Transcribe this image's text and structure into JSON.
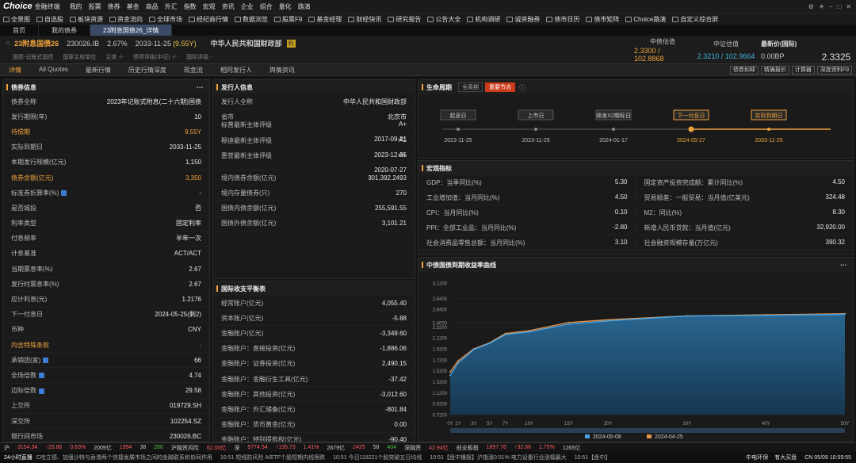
{
  "app": {
    "logo": "Choice",
    "logo_sub": "金融终端"
  },
  "menu": [
    "我的",
    "股票",
    "债券",
    "基金",
    "商品",
    "外汇",
    "指数",
    "宏观",
    "资讯",
    "企业",
    "组合",
    "量化",
    "路演"
  ],
  "toolbar": [
    "全景图",
    "自选股",
    "板块资源",
    "资金流向",
    "全球市场",
    "经纪商行情",
    "数据浏览",
    "股票F9",
    "基金经理",
    "财经快讯",
    "研究报告",
    "公告大全",
    "机构调研",
    "诚资融券",
    "债市日历",
    "债市矩阵",
    "Choice路演",
    "自定义综合屏"
  ],
  "tabs": [
    "首页",
    "我的债券",
    "23附息国债26_详情"
  ],
  "bond": {
    "name": "23附息国债26",
    "code": "230026.IB",
    "rate": "2.67%",
    "maturity": "2033-11-25",
    "maturity_left": "(9.55Y)",
    "issuer": "中华人民共和国财政部",
    "badge": "利",
    "row2": [
      "国债-记账式国债",
      "国家主权单位",
      "主体 -/-",
      "债项评级(中证) -/-",
      "国际评级 -"
    ]
  },
  "quotes": [
    {
      "label": "中债估值",
      "value": "2.3300 / 102.8868"
    },
    {
      "label": "中证估值",
      "value": "2.3210 / 102.9664"
    },
    {
      "label": "最新价(国际)",
      "value": "0.00BP"
    }
  ],
  "last_price": "2.3325",
  "subtabs": [
    "详情",
    "All Quotes",
    "最新行情",
    "历史行情深度",
    "现金流",
    "相同发行人",
    "舆情资讯"
  ],
  "subtab_buttons": [
    "债券如释",
    "精确报价",
    "计算器",
    "深度资料F9"
  ],
  "bond_info": {
    "title": "债券信息",
    "rows": [
      {
        "l": "债券全称",
        "v": "2023年记账式附息(二十六期)国债"
      },
      {
        "l": "发行期限(年)",
        "v": "10"
      },
      {
        "l": "待偿期",
        "v": "9.55Y",
        "hl": true
      },
      {
        "l": "实际到期日",
        "v": "2033-11-25"
      },
      {
        "l": "本期发行规模(亿元)",
        "v": "1,150"
      },
      {
        "l": "债券余额(亿元)",
        "v": "3,350",
        "hl": true
      },
      {
        "l": "标准券折算率(%)",
        "v": "-",
        "mark": true
      },
      {
        "l": "是否城投",
        "v": "否"
      },
      {
        "l": "利率类型",
        "v": "固定利率"
      },
      {
        "l": "付息频率",
        "v": "半年一次"
      },
      {
        "l": "计息基准",
        "v": "ACT/ACT"
      },
      {
        "l": "当期票息率(%)",
        "v": "2.67"
      },
      {
        "l": "发行时票息率(%)",
        "v": "2.67"
      },
      {
        "l": "应计利息(元)",
        "v": "1.2176"
      },
      {
        "l": "下一付息日",
        "v": "2024-05-25(剩2)"
      },
      {
        "l": "币种",
        "v": "CNY"
      },
      {
        "l": "内含特殊条款",
        "v": "-",
        "hl": true
      },
      {
        "l": "承销团(家)",
        "v": "66",
        "mark": true
      },
      {
        "l": "全场倍数",
        "v": "4.74",
        "mark": true
      },
      {
        "l": "边际倍数",
        "v": "29.58",
        "mark": true
      },
      {
        "l": "上交所",
        "v": "019729.SH"
      },
      {
        "l": "深交所",
        "v": "102254.SZ"
      },
      {
        "l": "银行间市场",
        "v": "230026.BC"
      }
    ]
  },
  "issuer_info": {
    "title": "发行人信息",
    "rows": [
      {
        "l": "发行人全称",
        "v": "中华人民共和国财政部"
      },
      {
        "l": "省市",
        "v": "北京市"
      }
    ],
    "ratings": [
      {
        "l": "标普最新主体评级",
        "v": "A+",
        "d": "2017-09-21"
      },
      {
        "l": "穆迪最新主体评级",
        "v": "A1",
        "d": "2023-12-05"
      },
      {
        "l": "惠誉最新主体评级",
        "v": "A+",
        "d": "2020-07-27"
      }
    ],
    "debt_rows": [
      {
        "l": "境内债券余额(亿元)",
        "v": "301,392.2493"
      },
      {
        "l": "境内存量债券(只)",
        "v": "270"
      },
      {
        "l": "国债内债余额(亿元)",
        "v": "255,591.55"
      },
      {
        "l": "国债外债余额(亿元)",
        "v": "3,101.21"
      }
    ]
  },
  "bop": {
    "title": "国际收支平衡表",
    "rows": [
      {
        "l": "经常账户(亿元)",
        "v": "4,055.40"
      },
      {
        "l": "资本账户(亿元)",
        "v": "-5.88"
      },
      {
        "l": "金融账户(亿元)",
        "v": "-3,349.60"
      },
      {
        "l": "金融账户：直接投资(亿元)",
        "v": "-1,886.06"
      },
      {
        "l": "金融账户：证券投资(亿元)",
        "v": "2,490.15"
      },
      {
        "l": "金融账户：金融衍生工具(亿元)",
        "v": "-37.42"
      },
      {
        "l": "金融账户：其他投资(亿元)",
        "v": "-3,012.60"
      },
      {
        "l": "金融账户：外汇储备(亿元)",
        "v": "-801.84"
      },
      {
        "l": "金融账户：货币黄金(亿元)",
        "v": "0.00"
      },
      {
        "l": "金融账户：特别提款权(亿元)",
        "v": "-90.40"
      }
    ]
  },
  "lifecycle": {
    "title": "生命周期",
    "tabs": [
      "全周期",
      "重要节点"
    ],
    "nodes": [
      {
        "label": "起息日",
        "date": "2023-11-25"
      },
      {
        "label": "上市日",
        "date": "2023-11-29"
      },
      {
        "label": "续发X2期标日",
        "date": "2024-01-17"
      },
      {
        "label": "下一付息日",
        "date": "2024-05-27"
      },
      {
        "label": "实际到期日",
        "date": "2033-11-25"
      }
    ]
  },
  "macro": {
    "title": "宏观指标",
    "rows": [
      [
        {
          "l": "GDP：当季同比(%)",
          "v": "5.30"
        },
        {
          "l": "固定资产投资完成额：累计同比(%)",
          "v": "4.50"
        }
      ],
      [
        {
          "l": "工业增加值：当月同比(%)",
          "v": "4.50"
        },
        {
          "l": "贸易顺差：一般贸易：当月值(亿美元)",
          "v": "324.48"
        }
      ],
      [
        {
          "l": "CPI：当月同比(%)",
          "v": "0.10"
        },
        {
          "l": "M2：同比(%)",
          "v": "8.30"
        }
      ],
      [
        {
          "l": "PPI：全部工业品：当月同比(%)",
          "v": "-2.80"
        },
        {
          "l": "新增人民币贷款：当月值(亿元)",
          "v": "32,920.00"
        }
      ],
      [
        {
          "l": "社会消费品零售总额：当月同比(%)",
          "v": "3.10"
        },
        {
          "l": "社会融资规模存量(万亿元)",
          "v": "390.32"
        }
      ]
    ]
  },
  "yield_title": "中债国债到期收益率曲线",
  "chart_data": {
    "type": "area",
    "x": [
      "0Y",
      "1Y",
      "3Y",
      "5Y",
      "7Y",
      "10Y",
      "15Y",
      "20Y",
      "30Y",
      "40Y",
      "50Y"
    ],
    "x_num": [
      0,
      1,
      3,
      5,
      7,
      10,
      15,
      20,
      30,
      40,
      50
    ],
    "series": [
      {
        "name": "2024-05-08",
        "color": "#4aa3e0",
        "values": [
          1.44,
          1.66,
          1.91,
          2.02,
          2.18,
          2.23,
          2.37,
          2.43,
          2.52,
          2.53,
          2.55
        ]
      },
      {
        "name": "2024-04-25",
        "color": "#e8934a",
        "values": [
          1.5,
          1.7,
          1.92,
          2.03,
          2.2,
          2.25,
          2.4,
          2.45,
          2.52,
          2.54,
          2.56
        ]
      }
    ],
    "yticks": [
      "0.7200",
      "0.9200",
      "1.1200",
      "1.3200",
      "1.5200",
      "1.7200",
      "1.9200",
      "2.1200",
      "2.3200",
      "2.4000",
      "2.6400",
      "2.8400",
      "3.1200"
    ],
    "ylim": [
      0.72,
      3.12
    ]
  },
  "statusbar": [
    {
      "t": "沪",
      "c": "#ccc"
    },
    {
      "t": "3154.34",
      "c": "#ff5b5b"
    },
    {
      "t": "↑25.86",
      "c": "#ff5b5b"
    },
    {
      "t": "0.83%",
      "c": "#ff5b5b"
    },
    {
      "t": "2009亿",
      "c": "#ccc"
    },
    {
      "t": "1994",
      "c": "#ff5b5b"
    },
    {
      "t": "38",
      "c": "#ccc"
    },
    {
      "t": "280",
      "c": "#49c249"
    },
    {
      "t": "沪融资风险",
      "c": "#ccc"
    },
    {
      "t": "62.00亿",
      "c": "#ff5b5b"
    },
    {
      "t": "深",
      "c": "#ccc"
    },
    {
      "t": "9774.54",
      "c": "#ff5b5b"
    },
    {
      "t": "↑135.73",
      "c": "#ff5b5b"
    },
    {
      "t": "1.41%",
      "c": "#ff5b5b"
    },
    {
      "t": "2679亿",
      "c": "#ccc"
    },
    {
      "t": "2425",
      "c": "#ff5b5b"
    },
    {
      "t": "58",
      "c": "#ccc"
    },
    {
      "t": "404",
      "c": "#49c249"
    },
    {
      "t": "深融资",
      "c": "#ccc"
    },
    {
      "t": "42.94亿",
      "c": "#ff5b5b"
    },
    {
      "t": "创业板指",
      "c": "#ccc"
    },
    {
      "t": "1897.76",
      "c": "#ff5b5b"
    },
    {
      "t": "↑32.66",
      "c": "#ff5b5b"
    },
    {
      "t": "1.75%",
      "c": "#ff5b5b"
    },
    {
      "t": "1265亿",
      "c": "#ccc"
    }
  ],
  "news": {
    "label": "24小时直播",
    "items": [
      "C哈立德、加强沙特与香港两个快捷发展市场之间的金融联系和协同作用",
      "10:51 短线防风险 A/ETF个股短期内线限跌",
      "10:51 今日118221个股突破五日均线",
      "10:51【盘中播报】沪指涨0.51% 电力设备行业涨幅最大",
      "10:51【盘中】"
    ],
    "right": [
      "中电环保",
      "有大买盘"
    ],
    "clock": "CN 05/09 10:59:55"
  }
}
